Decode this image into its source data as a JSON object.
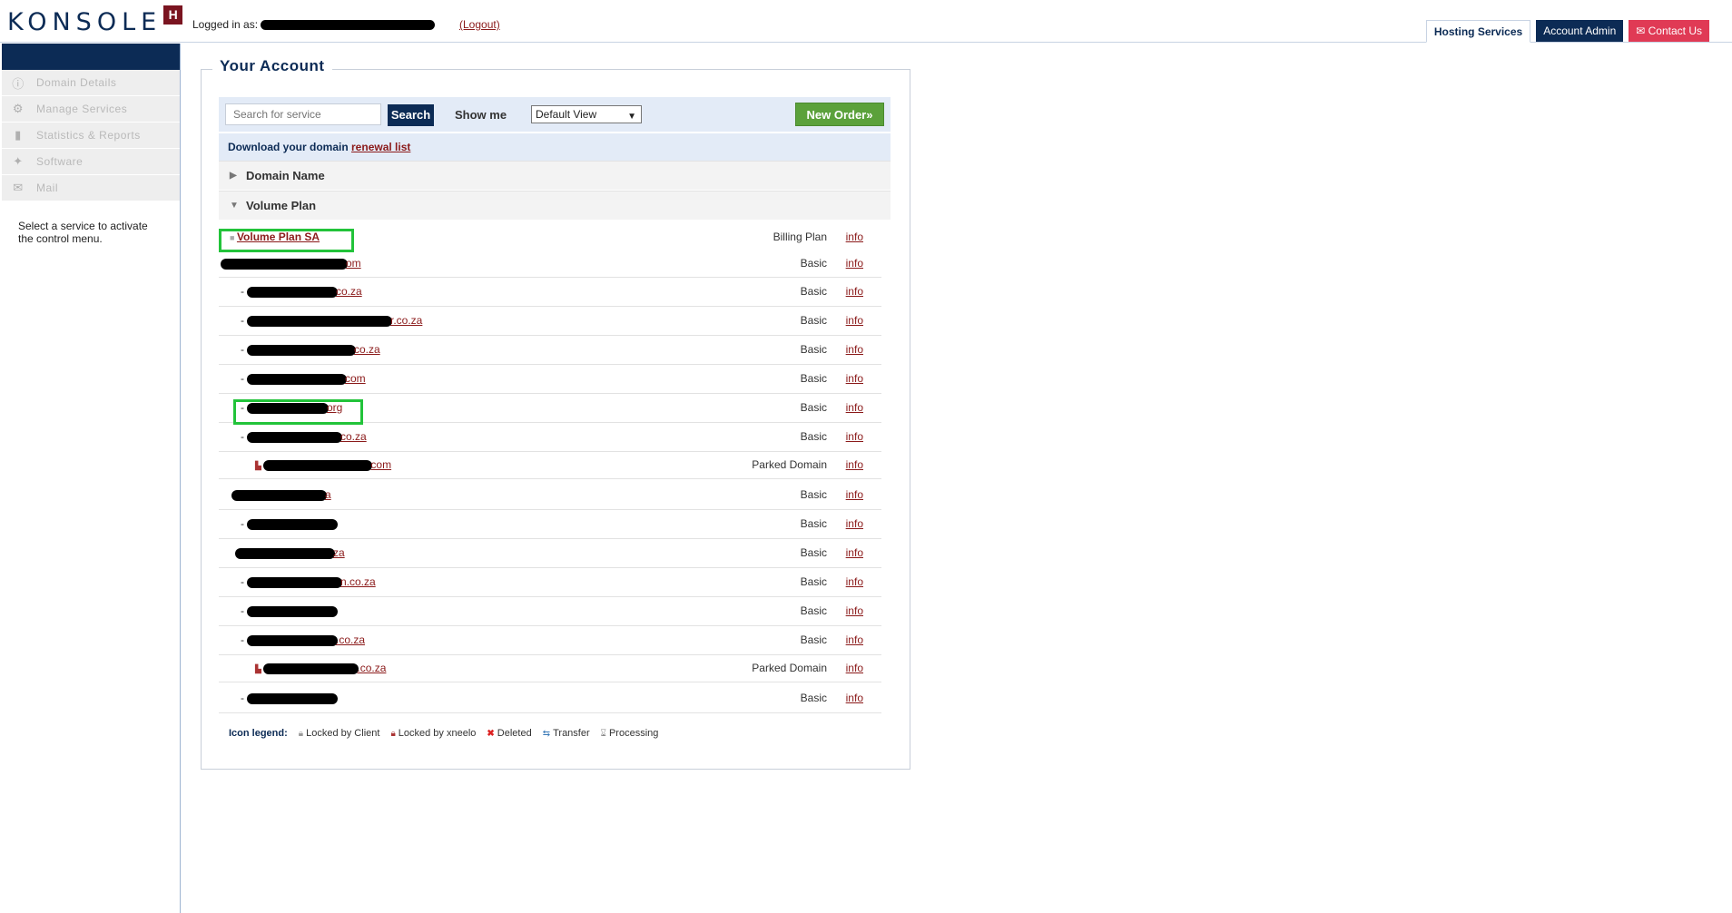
{
  "header": {
    "logo_text": "KONSOLE",
    "logo_badge": "H",
    "logged_in_label": "Logged in as:",
    "logout_label": "(Logout)",
    "nav": {
      "hosting": "Hosting Services",
      "admin": "Account Admin",
      "contact": "Contact Us"
    }
  },
  "sidebar": {
    "items": [
      {
        "label": "Domain Details",
        "icon": "info-icon"
      },
      {
        "label": "Manage Services",
        "icon": "wrench-icon"
      },
      {
        "label": "Statistics & Reports",
        "icon": "bar-chart-icon"
      },
      {
        "label": "Software",
        "icon": "software-icon"
      },
      {
        "label": "Mail",
        "icon": "envelope-icon"
      }
    ],
    "note": "Select a service to activate the control menu."
  },
  "main": {
    "title": "Your Account",
    "search_placeholder": "Search for service",
    "search_button": "Search",
    "show_me_label": "Show me",
    "view_selected": "Default View",
    "new_order_label": "New Order»",
    "renewal_text": "Download your domain",
    "renewal_link": "renewal list",
    "groups": {
      "domain_name": "Domain Name",
      "volume_plan": "Volume Plan"
    },
    "plan_row": {
      "name": "Volume Plan SA",
      "plan": "Billing Plan",
      "info": "info"
    },
    "rows": [
      {
        "suffix": "om",
        "plan": "Basic",
        "info": "info"
      },
      {
        "suffix": "co.za",
        "plan": "Basic",
        "info": "info"
      },
      {
        "suffix": "r.co.za",
        "plan": "Basic",
        "info": "info"
      },
      {
        "suffix": "co.za",
        "plan": "Basic",
        "info": "info"
      },
      {
        "suffix": "com",
        "plan": "Basic",
        "info": "info"
      },
      {
        "suffix": "org",
        "plan": "Basic",
        "info": "info"
      },
      {
        "suffix": "co.za",
        "plan": "Basic",
        "info": "info"
      },
      {
        "suffix": "com",
        "plan": "Parked Domain",
        "info": "info"
      },
      {
        "suffix": "a",
        "plan": "Basic",
        "info": "info"
      },
      {
        "suffix": "",
        "plan": "Basic",
        "info": "info"
      },
      {
        "suffix": "za",
        "plan": "Basic",
        "info": "info"
      },
      {
        "suffix": "n.co.za",
        "plan": "Basic",
        "info": "info"
      },
      {
        "suffix": "",
        "plan": "Basic",
        "info": "info"
      },
      {
        "suffix": ".co.za",
        "plan": "Basic",
        "info": "info"
      },
      {
        "suffix": ".co.za",
        "plan": "Parked Domain",
        "info": "info"
      },
      {
        "suffix": "",
        "plan": "Basic",
        "info": "info"
      }
    ],
    "legend": {
      "title": "Icon legend:",
      "locked_client": "Locked by Client",
      "locked_xneelo": "Locked by xneelo",
      "deleted": "Deleted",
      "transfer": "Transfer",
      "processing": "Processing"
    }
  }
}
